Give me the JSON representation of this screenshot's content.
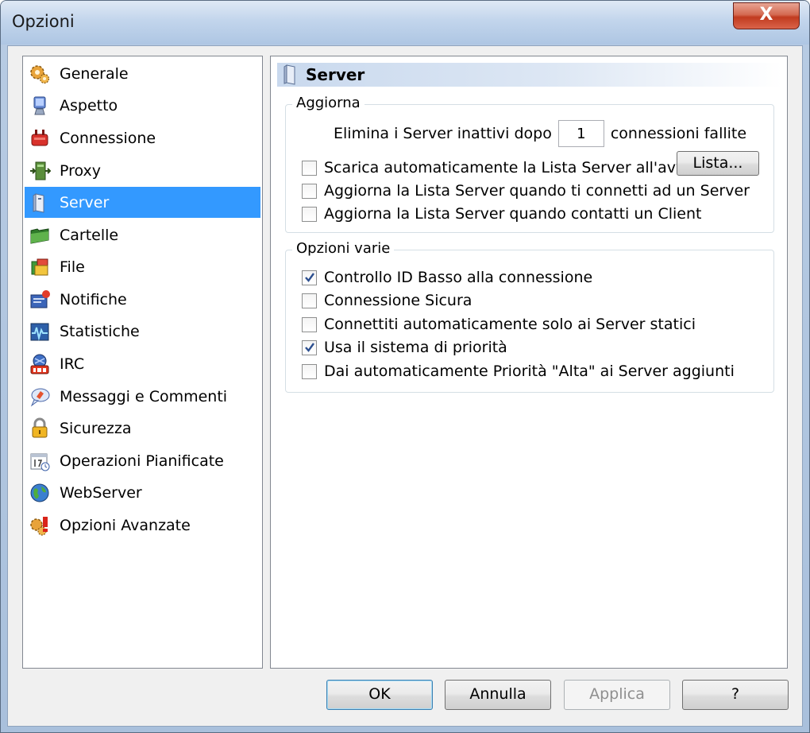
{
  "window": {
    "title": "Opzioni",
    "close_label": "X"
  },
  "sidebar": {
    "items": [
      {
        "label": "Generale",
        "icon": "gears-icon"
      },
      {
        "label": "Aspetto",
        "icon": "monitor-icon"
      },
      {
        "label": "Connessione",
        "icon": "plug-icon"
      },
      {
        "label": "Proxy",
        "icon": "proxy-icon"
      },
      {
        "label": "Server",
        "icon": "server-icon",
        "selected": true
      },
      {
        "label": "Cartelle",
        "icon": "folder-icon"
      },
      {
        "label": "File",
        "icon": "file-icon"
      },
      {
        "label": "Notifiche",
        "icon": "notification-icon"
      },
      {
        "label": "Statistiche",
        "icon": "statistics-icon"
      },
      {
        "label": "IRC",
        "icon": "irc-icon"
      },
      {
        "label": "Messaggi e Commenti",
        "icon": "messages-icon"
      },
      {
        "label": "Sicurezza",
        "icon": "lock-icon"
      },
      {
        "label": "Operazioni Pianificate",
        "icon": "calendar-icon"
      },
      {
        "label": "WebServer",
        "icon": "globe-icon"
      },
      {
        "label": "Opzioni Avanzate",
        "icon": "advanced-options-icon"
      }
    ]
  },
  "panel": {
    "title": "Server",
    "update_group": {
      "title": "Aggiorna",
      "remove_prefix": "Elimina i Server inattivi dopo",
      "remove_value": "1",
      "remove_suffix": "connessioni fallite",
      "options": [
        {
          "label": "Scarica automaticamente la Lista Server all'avvio",
          "checked": false
        },
        {
          "label": "Aggiorna la Lista Server quando ti connetti ad un Server",
          "checked": false
        },
        {
          "label": "Aggiorna la Lista Server quando contatti un Client",
          "checked": false
        }
      ],
      "list_button": "Lista..."
    },
    "misc_group": {
      "title": "Opzioni varie",
      "options": [
        {
          "label": "Controllo ID Basso alla connessione",
          "checked": true
        },
        {
          "label": "Connessione Sicura",
          "checked": false
        },
        {
          "label": "Connettiti automaticamente solo ai Server statici",
          "checked": false
        },
        {
          "label": "Usa il sistema di priorità",
          "checked": true
        },
        {
          "label": "Dai automaticamente Priorità \"Alta\" ai Server aggiunti",
          "checked": false
        }
      ]
    }
  },
  "footer": {
    "ok": "OK",
    "cancel": "Annulla",
    "apply": "Applica",
    "help": "?"
  },
  "colors": {
    "selection": "#3399ff",
    "checkmark": "#2c4f8f"
  }
}
